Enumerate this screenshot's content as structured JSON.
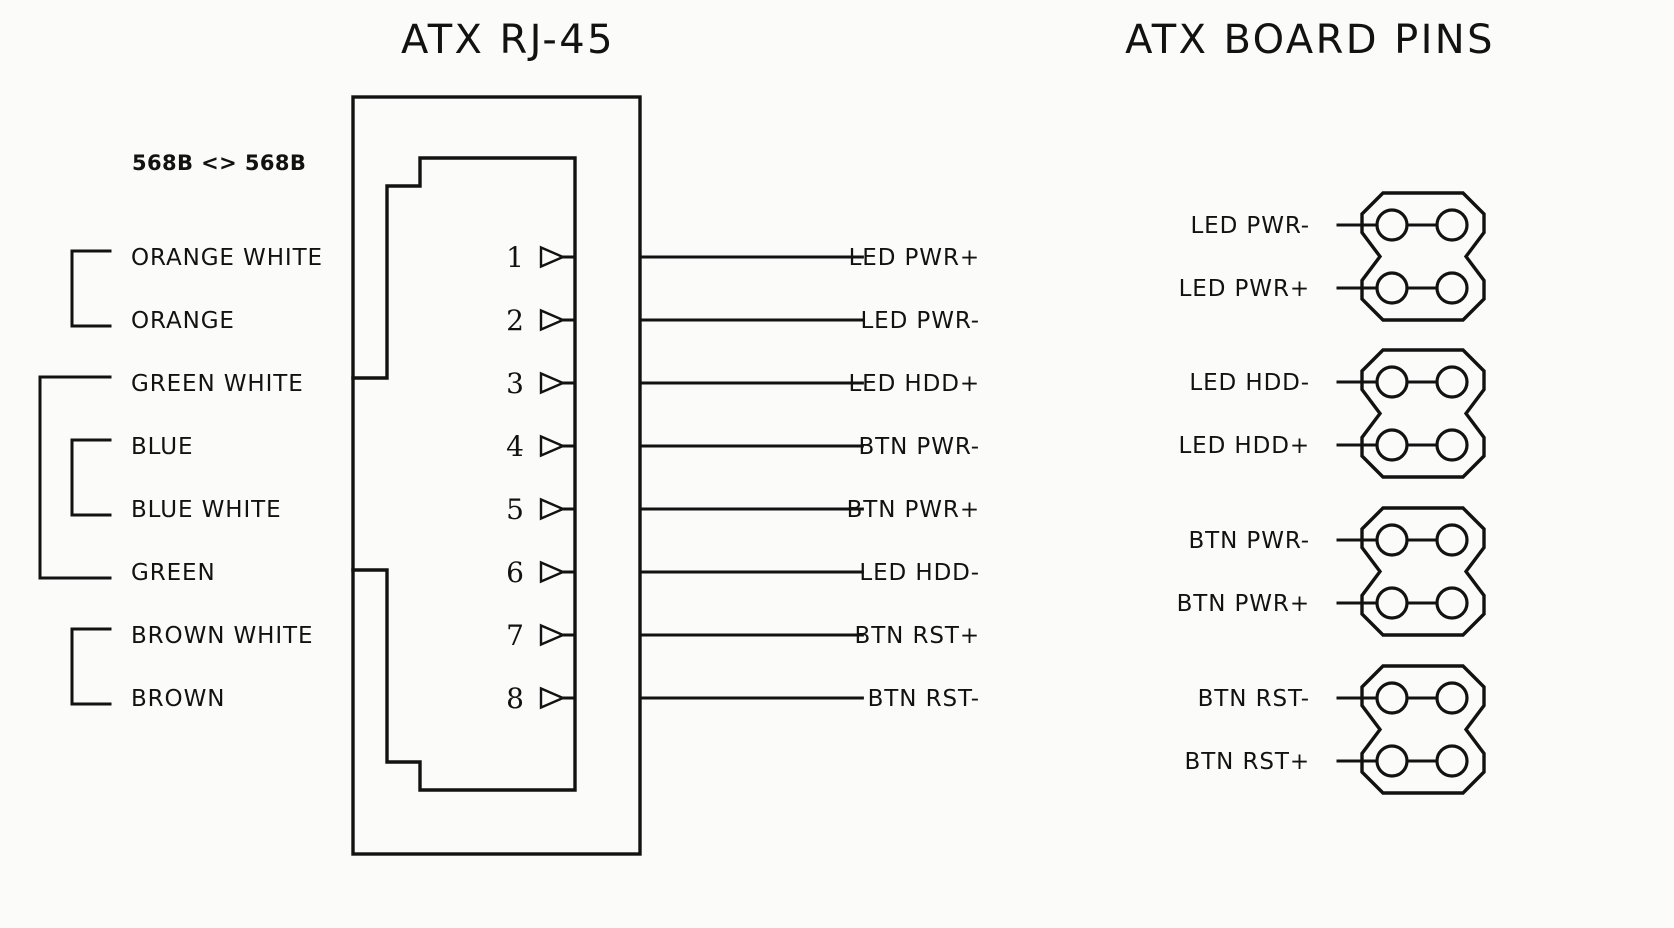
{
  "headings": {
    "left_title": "ATX RJ-45",
    "right_title": "ATX BOARD PINS"
  },
  "standard_note": "568B <> 568B",
  "wire_pairs": {
    "pair1_label": "pair-orange",
    "pair2_label": "pair-green-blue",
    "pair3_label": "pair-brown"
  },
  "rows": [
    {
      "pin": "1",
      "wire": "ORANGE WHITE",
      "signal": "LED PWR+",
      "short_line": false
    },
    {
      "pin": "2",
      "wire": "ORANGE",
      "signal": "LED PWR-",
      "short_line": false
    },
    {
      "pin": "3",
      "wire": "GREEN WHITE",
      "signal": "LED HDD+",
      "short_line": true
    },
    {
      "pin": "4",
      "wire": "BLUE",
      "signal": "BTN PWR-",
      "short_line": false
    },
    {
      "pin": "5",
      "wire": "BLUE WHITE",
      "signal": "BTN PWR+",
      "short_line": false
    },
    {
      "pin": "6",
      "wire": "GREEN",
      "signal": "LED HDD-",
      "short_line": true
    },
    {
      "pin": "7",
      "wire": "BROWN WHITE",
      "signal": "BTN RST+",
      "short_line": false
    },
    {
      "pin": "8",
      "wire": "BROWN",
      "signal": "BTN RST-",
      "short_line": false
    }
  ],
  "board_headers": [
    {
      "name": "header-led-pwr",
      "top_label": "LED PWR-",
      "bottom_label": "LED PWR+"
    },
    {
      "name": "header-led-hdd",
      "top_label": "LED HDD-",
      "bottom_label": "LED HDD+"
    },
    {
      "name": "header-btn-pwr",
      "top_label": "BTN PWR-",
      "bottom_label": "BTN PWR+"
    },
    {
      "name": "header-btn-rst",
      "top_label": "BTN RST-",
      "bottom_label": "BTN RST+"
    }
  ],
  "colors": {
    "ink": "#121212",
    "paper": "#fbfbfa"
  }
}
